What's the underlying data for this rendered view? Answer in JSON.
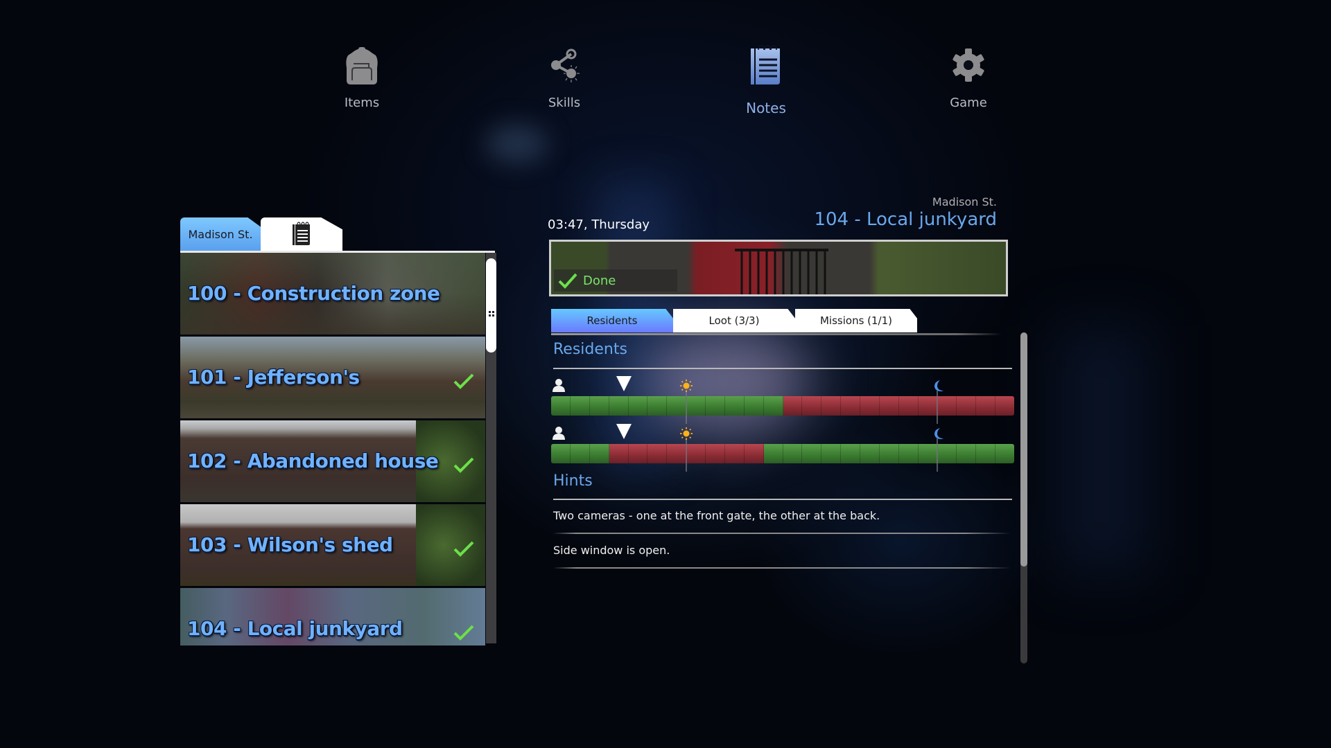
{
  "nav": {
    "items": [
      {
        "label": "Items",
        "icon": "backpack-icon",
        "active": false
      },
      {
        "label": "Skills",
        "icon": "share-nodes-icon",
        "active": false
      },
      {
        "label": "Notes",
        "icon": "notepad-icon",
        "active": true
      },
      {
        "label": "Game",
        "icon": "gear-icon",
        "active": false
      }
    ]
  },
  "left_panel": {
    "tabs": [
      {
        "label": "Madison St.",
        "active": true
      },
      {
        "icon": "notepad-icon",
        "active": false
      }
    ],
    "locations": [
      {
        "title": "100 - Construction zone",
        "done": false,
        "selected": false
      },
      {
        "title": "101 - Jefferson's",
        "done": true,
        "selected": false
      },
      {
        "title": "102 - Abandoned house",
        "done": true,
        "selected": false
      },
      {
        "title": "103 - Wilson's shed",
        "done": true,
        "selected": false
      },
      {
        "title": "104 - Local junkyard",
        "done": true,
        "selected": true
      }
    ],
    "scroll_position_fraction": 0.0
  },
  "detail": {
    "street": "Madison St.",
    "title": "104 - Local junkyard",
    "time": "03:47, Thursday",
    "status": "Done",
    "tabs": [
      {
        "label": "Residents",
        "active": true
      },
      {
        "label": "Loot (3/3)",
        "active": false
      },
      {
        "label": "Missions (1/1)",
        "active": false
      }
    ],
    "residents_heading": "Residents",
    "schedule": {
      "hours_per_day": 24,
      "current_hour": 3.78,
      "sunrise_hour": 7,
      "sunset_hour": 20,
      "residents": [
        {
          "icon": "person-icon",
          "hours": [
            "home",
            "home",
            "home",
            "home",
            "home",
            "home",
            "home",
            "home",
            "home",
            "home",
            "home",
            "home",
            "away",
            "away",
            "away",
            "away",
            "away",
            "away",
            "away",
            "away",
            "away",
            "away",
            "away",
            "away"
          ]
        },
        {
          "icon": "person-icon",
          "hours": [
            "home",
            "home",
            "home",
            "away",
            "away",
            "away",
            "away",
            "away",
            "away",
            "away",
            "away",
            "home",
            "home",
            "home",
            "home",
            "home",
            "home",
            "home",
            "home",
            "home",
            "home",
            "home",
            "home",
            "home"
          ]
        }
      ]
    },
    "hints_heading": "Hints",
    "hints": [
      "Two cameras - one at the front gate, the other at the back.",
      "Side window is open."
    ]
  },
  "colors": {
    "accent_blue": "#6aa8ec",
    "home_green": "#4a8c3c",
    "away_red": "#a03a44",
    "done_green": "#7be36a"
  }
}
